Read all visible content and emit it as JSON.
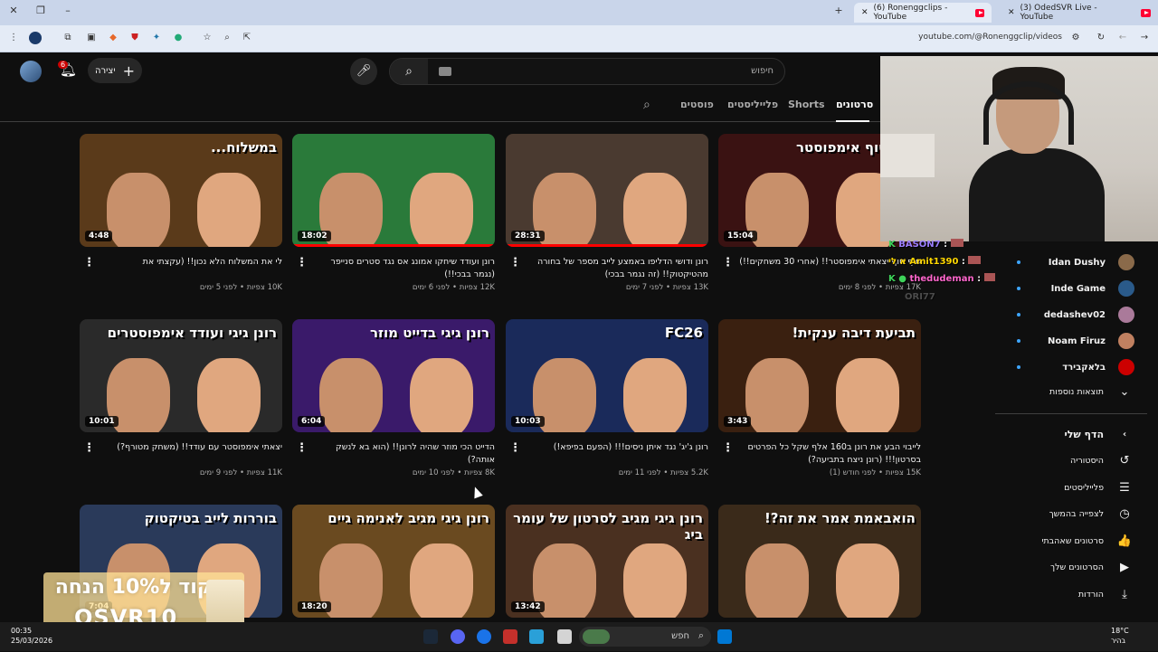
{
  "browser": {
    "tabs": [
      {
        "title": "(6) Ronenggclips - YouTube",
        "active": true
      },
      {
        "title": "(3) OdedSVR Live - YouTube",
        "active": false
      }
    ],
    "url": "youtube.com/@Ronenggclip/videos"
  },
  "header": {
    "notification_count": "6",
    "create_label": "יצירה",
    "search_placeholder": "חיפוש"
  },
  "channel_tabs": [
    {
      "label": "סרטונים",
      "active": true
    },
    {
      "label": "Shorts",
      "active": false
    },
    {
      "label": "פלייליסטים",
      "active": false
    },
    {
      "label": "פוסטים",
      "active": false
    }
  ],
  "videos": [
    {
      "title": "סוף סוף יצאתי אימפוסטר!! (אחרי 30 משחקים!!)",
      "views": "17K צפיות",
      "age": "לפני 8 ימים",
      "duration": "15:04",
      "caption": "סוף סוף אימפוסטר",
      "bg": "#3a1212",
      "progress": 0
    },
    {
      "title": "רונן ודושי הדליפו באמצע לייב מספר של בחורה מהטיקטוק!! (זה נגמר בבכי)",
      "views": "13K צפיות",
      "age": "לפני 7 ימים",
      "duration": "28:31",
      "caption": "",
      "bg": "#4a3a30",
      "progress": 1
    },
    {
      "title": "רונן ועודד שיחקו אמונג אס נגד סטרים סנייפר (נגמר בבכי!!)",
      "views": "12K צפיות",
      "age": "לפני 6 ימים",
      "duration": "18:02",
      "caption": "",
      "bg": "#2a7a3a",
      "progress": 1
    },
    {
      "title": "לי את המשלוח הלא נכון!! (עקצתי את",
      "views": "10K צפיות",
      "age": "לפני 5 ימים",
      "duration": "4:48",
      "caption": "במשלוח...",
      "bg": "#5a3a1a",
      "progress": 0
    },
    {
      "title": "לייבוי הבע את רונן ב160 אלף שקל כל הפרטים בסרטון!!! (רונן ניצח בתביעה?)",
      "views": "15K צפיות",
      "age": "לפני חודש (1)",
      "duration": "3:43",
      "caption": "תביעת דיבה ענקית!",
      "bg": "#3a2010",
      "progress": 0
    },
    {
      "title": "רונן ג'יג' נגד איתן ניסים!!! (הפעם בפיפא!)",
      "views": "5.2K צפיות",
      "age": "לפני 11 ימים",
      "duration": "10:03",
      "caption": "FC26",
      "bg": "#1a2a5a",
      "progress": 0
    },
    {
      "title": "הדייט הכי מוזר שהיה לרונן!! (הוא בא לנשק אותה?)",
      "views": "8K צפיות",
      "age": "לפני 10 ימים",
      "duration": "6:04",
      "caption": "רונן גיגי בדייט מוזר",
      "bg": "#3a1a6a",
      "progress": 0
    },
    {
      "title": "יצאתי אימפוסטר עם עודד!! (משחק מטורף?)",
      "views": "11K צפיות",
      "age": "לפני 9 ימים",
      "duration": "10:01",
      "caption": "רונן גיגי ועודד אימפוסטרים",
      "bg": "#2a2a2a",
      "progress": 0
    },
    {
      "title": "",
      "views": "",
      "age": "",
      "duration": "",
      "caption": "הואבאמת אמר את זה?!",
      "bg": "#3a2a1a",
      "progress": 0
    },
    {
      "title": "",
      "views": "",
      "age": "",
      "duration": "13:42",
      "caption": "רונן גיגי מגיב לסרטון של עומר ביג",
      "bg": "#4a3020",
      "progress": 0
    },
    {
      "title": "",
      "views": "",
      "age": "",
      "duration": "18:20",
      "caption": "רונן גיגי מגיב לאנימה גיים",
      "bg": "#6a4a20",
      "progress": 0
    },
    {
      "title": "",
      "views": "",
      "age": "",
      "duration": "7:04",
      "caption": "בוררות לייב בטיקטוק",
      "bg": "#2a3a5a",
      "progress": 0
    }
  ],
  "sidebar": {
    "subscriptions": [
      {
        "name": "Idan Dushy",
        "color": "#8a6a4a"
      },
      {
        "name": "Inde Game",
        "color": "#2a5a8a"
      },
      {
        "name": "dedashev02",
        "color": "#aa7a9a"
      },
      {
        "name": "Noam Firuz",
        "color": "#c08060"
      },
      {
        "name": "בלאקבירד",
        "color": "#cc0000"
      }
    ],
    "show_more_label": "תוצאות נוספות",
    "you_label": "הדף שלי",
    "you_items": [
      {
        "label": "היסטוריה",
        "icon": "history-icon",
        "glyph": "↺"
      },
      {
        "label": "פלייליסטים",
        "icon": "playlists-icon",
        "glyph": "☰"
      },
      {
        "label": "לצפייה בהמשך",
        "icon": "watch-later-icon",
        "glyph": "◷"
      },
      {
        "label": "סרטונים שאהבתי",
        "icon": "like-icon",
        "glyph": "👍"
      },
      {
        "label": "הסרטונים שלך",
        "icon": "your-videos-icon",
        "glyph": "▶"
      },
      {
        "label": "הורדות",
        "icon": "download-icon",
        "glyph": "⤓"
      }
    ]
  },
  "chat": [
    {
      "user": "BASON7",
      "color": "#3ed35a"
    },
    {
      "user": "Amit1390",
      "color": "#ffd700"
    },
    {
      "user": "thedudeman",
      "color": "#ff66cc"
    },
    {
      "user": "ORI77",
      "color": "#888888"
    }
  ],
  "promo": {
    "line1": "קוד ל10% הנחה",
    "line2": "OSVR10"
  },
  "taskbar": {
    "time": "00:35",
    "date": "25/03/2026",
    "search_label": "חפש",
    "weather_temp": "18°C",
    "weather_text": "בהיר"
  }
}
